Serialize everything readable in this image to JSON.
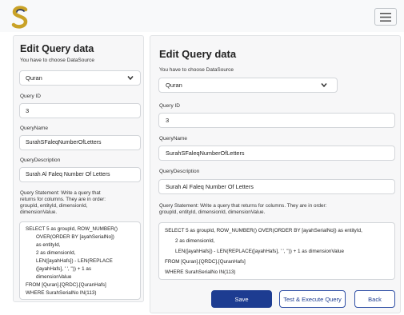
{
  "navbar": {
    "logo_icon": "s-logo-icon",
    "menu_icon": "hamburger-menu-icon"
  },
  "form": {
    "title": "Edit Query data",
    "datasource_label": "You have to choose DataSource",
    "datasource_value": "Quran",
    "query_id_label": "Query ID",
    "query_id_value": "3",
    "query_name_label": "QueryName",
    "query_name_value": "SurahSFaleqNumberOfLetters",
    "query_description_label": "QueryDescription",
    "query_description_value": "Surah Al Faleq Number Of Letters",
    "statement_label_left": [
      "Query Statement: Write a query that",
      "returns for columns. They are in order:",
      "groupId, entityId, dimensionId,",
      "dimensionValue."
    ],
    "statement_label_right": [
      "Query Statement: Write a query that returns for columns. They are in order:",
      "groupId, entityId, dimensionId, dimensionValue."
    ],
    "statement_left_lines": [
      "SELECT    5 as groupId, ROW_NUMBER()",
      "OVER(ORDER BY [ayahSerialNo])",
      "as entityId,",
      "2 as dimensionId,",
      "LEN([ayahHafs]) - LEN(REPLACE",
      "([ayahHafs], ' ', '')) + 1 as",
      "dimensionValue",
      "FROM [Quran].[QRDC].[QuranHafs]",
      "WHERE SurahSerialNo IN(113)"
    ],
    "statement_right_lines": [
      "SELECT    5 as groupId, ROW_NUMBER() OVER(ORDER BY [ayahSerialNo]) as entityId,",
      "2 as dimensionId,",
      "LEN([ayahHafs]) - LEN(REPLACE([ayahHafs], ' ', '')) + 1 as dimensionValue",
      "FROM [Quran].[QRDC].[QuranHafs]",
      "WHERE SurahSerialNo IN(113)"
    ]
  },
  "buttons": {
    "save": "Save",
    "test_execute": "Test & Execute Query",
    "back": "Back"
  },
  "colors": {
    "primary": "#1d3c91",
    "logo_gold": "#c9a227",
    "logo_navy": "#1e2d5a"
  }
}
